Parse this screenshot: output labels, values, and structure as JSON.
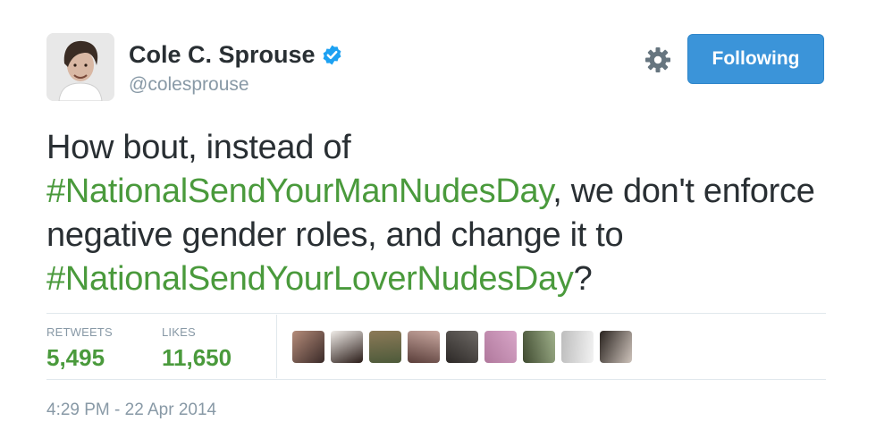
{
  "user": {
    "name": "Cole C. Sprouse",
    "handle": "@colesprouse",
    "verified": true
  },
  "actions": {
    "follow_label": "Following"
  },
  "tweet": {
    "segments": [
      {
        "type": "text",
        "value": "How bout, instead of "
      },
      {
        "type": "hashtag",
        "value": "#NationalSendYourManNudesDay"
      },
      {
        "type": "text",
        "value": ", we don't enforce negative gender roles, and change it to "
      },
      {
        "type": "hashtag",
        "value": "#NationalSendYourLoverNudesDay"
      },
      {
        "type": "text",
        "value": "?"
      }
    ]
  },
  "stats": {
    "retweets_label": "RETWEETS",
    "retweets": "5,495",
    "likes_label": "LIKES",
    "likes": "11,650"
  },
  "likers": [
    {
      "colors": [
        "#b58c7a",
        "#3a2a28"
      ]
    },
    {
      "colors": [
        "#f0ece8",
        "#2a1c18"
      ]
    },
    {
      "colors": [
        "#8c7a58",
        "#4d5a3a"
      ]
    },
    {
      "colors": [
        "#c9a8a0",
        "#5a3e3a"
      ]
    },
    {
      "colors": [
        "#6e6a66",
        "#2c2826"
      ]
    },
    {
      "colors": [
        "#d8a6c8",
        "#b0789c"
      ]
    },
    {
      "colors": [
        "#9fb08a",
        "#3f4a30"
      ]
    },
    {
      "colors": [
        "#f2f2f2",
        "#bdbdbd"
      ]
    },
    {
      "colors": [
        "#cfc4bc",
        "#2a2420"
      ]
    }
  ],
  "timestamp": "4:29 PM - 22 Apr 2014",
  "colors": {
    "accent": "#3b94d9",
    "hashtag": "#4a9a3c",
    "muted": "#8899a6",
    "text": "#292f33"
  }
}
